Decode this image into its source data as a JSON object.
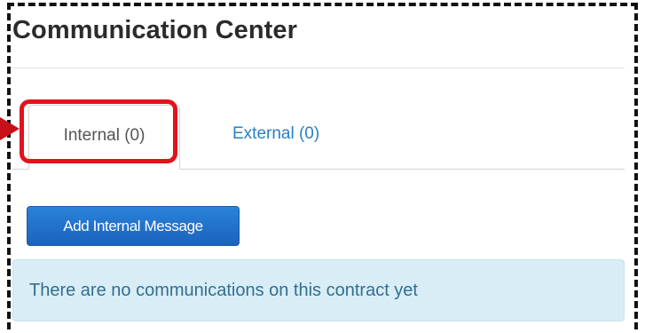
{
  "communication_center": {
    "title": "Communication Center",
    "tabs": [
      {
        "label": "Internal (0)",
        "active": true
      },
      {
        "label": "External (0)",
        "active": false
      }
    ],
    "add_button_label": "Add Internal Message",
    "empty_message": "There are no communications on this contract yet"
  },
  "colors": {
    "highlight": "#e3121b",
    "arrow": "#c8101a",
    "link": "#2a7fc4",
    "button": "#1b63bc",
    "alert_background": "#d9edf7"
  },
  "icons": {
    "callout": "callout-arrow-icon"
  }
}
